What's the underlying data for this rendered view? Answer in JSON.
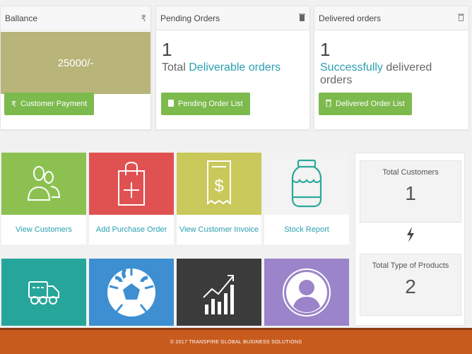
{
  "balance": {
    "title": "Ballance",
    "icon": "rupee-icon",
    "amount": "25000/-",
    "button_label": "Customer Payment",
    "box_color": "#b8b47a"
  },
  "pending": {
    "title": "Pending Orders",
    "icon": "trash-icon",
    "count": "1",
    "prefix": "Total ",
    "accent": "Deliverable orders",
    "button_label": "Pending Order List"
  },
  "delivered": {
    "title": "Delivered orders",
    "icon": "trash-icon",
    "count": "1",
    "accent": "Successfully",
    "suffix": " delivered orders",
    "button_label": "Delivered Order List"
  },
  "tiles": [
    {
      "label": "View Customers",
      "icon": "users-icon",
      "color": "#8cc152"
    },
    {
      "label": "Add Purchase Order",
      "icon": "shopping-bag-icon",
      "color": "#e05151"
    },
    {
      "label": "View Customer Invoice",
      "icon": "invoice-icon",
      "color": "#c9c85a"
    },
    {
      "label": "Stock Report",
      "icon": "jar-icon",
      "color": "#f3f3f3"
    },
    {
      "label": "",
      "icon": "truck-icon",
      "color": "#26a69a"
    },
    {
      "label": "",
      "icon": "soccer-ball-icon",
      "color": "#3d8fd1"
    },
    {
      "label": "",
      "icon": "bar-chart-icon",
      "color": "#3b3b3b"
    },
    {
      "label": "",
      "icon": "user-icon",
      "color": "#9b84c9"
    }
  ],
  "stats": {
    "customers_title": "Total Customers",
    "customers_value": "1",
    "products_title": "Total Type of Products",
    "products_value": "2"
  },
  "footer": {
    "text": "© 2017 TRANSPIRE GLOBAL BUSINESS SOLUTIONS"
  }
}
